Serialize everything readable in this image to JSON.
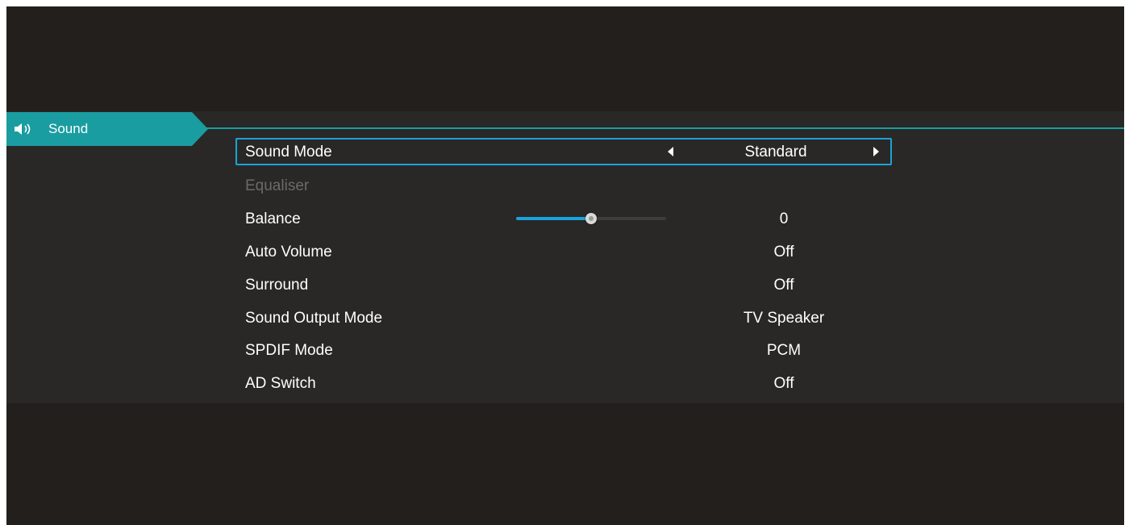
{
  "header": {
    "title": "Sound",
    "icon": "speaker-icon",
    "accent_color": "#1a9da1"
  },
  "menu": {
    "sound_mode": {
      "label": "Sound Mode",
      "value": "Standard"
    },
    "equaliser": {
      "label": "Equaliser"
    },
    "balance": {
      "label": "Balance",
      "value": "0",
      "level": 0.5
    },
    "auto_volume": {
      "label": "Auto Volume",
      "value": "Off"
    },
    "surround": {
      "label": "Surround",
      "value": "Off"
    },
    "sound_output_mode": {
      "label": "Sound Output Mode",
      "value": "TV Speaker"
    },
    "spdif_mode": {
      "label": "SPDIF Mode",
      "value": "PCM"
    },
    "ad_switch": {
      "label": "AD Switch",
      "value": "Off"
    }
  },
  "colors": {
    "selection_border": "#1aa3dc",
    "slider_fill": "#1aa3dc",
    "disabled_text": "#6b6a68"
  }
}
